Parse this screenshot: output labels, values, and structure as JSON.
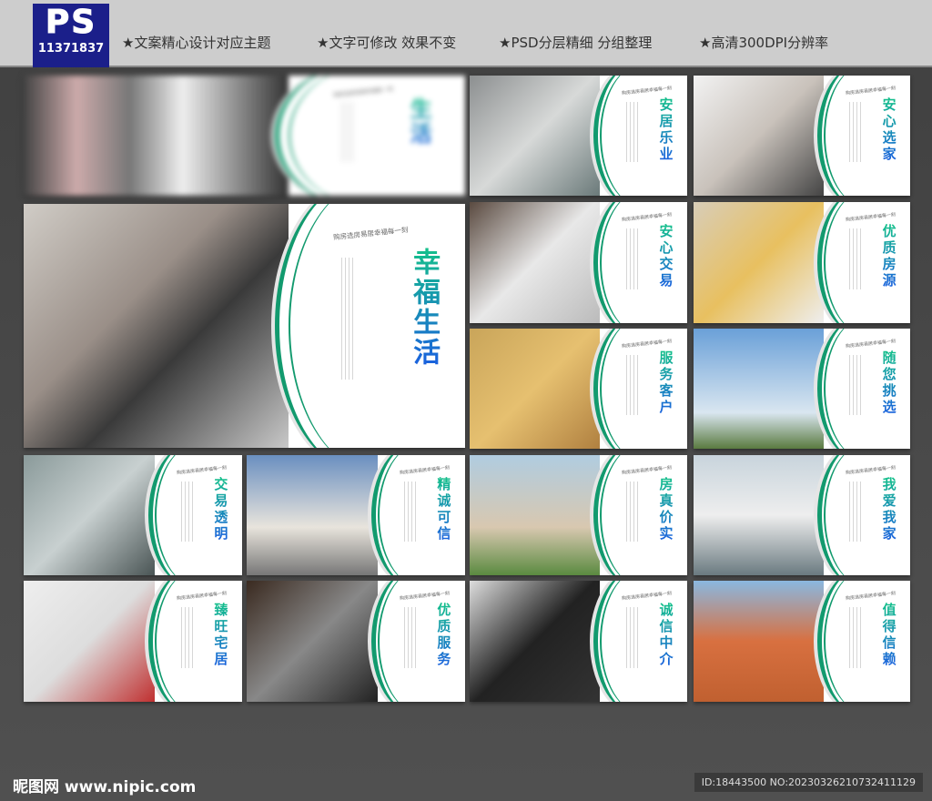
{
  "header": {
    "logo_text": "PS",
    "logo_id": "11371837",
    "features": [
      "★文案精心设计对应主题",
      "★文字可修改 效果不变",
      "★PSD分层精细 分组整理",
      "★高清300DPI分辨率"
    ]
  },
  "tagline": "购房选房易居幸福每一刻",
  "big_card": {
    "title": "幸福生活"
  },
  "blurred_card": {
    "title": "生活"
  },
  "cards": [
    {
      "title": "安居乐业"
    },
    {
      "title": "安心选家"
    },
    {
      "title": "安心交易"
    },
    {
      "title": "优质房源"
    },
    {
      "title": "服务客户"
    },
    {
      "title": "随您挑选"
    },
    {
      "title": "交易透明"
    },
    {
      "title": "精诚可信"
    },
    {
      "title": "房真价实"
    },
    {
      "title": "我爱我家"
    },
    {
      "title": "臻旺宅居"
    },
    {
      "title": "优质服务"
    },
    {
      "title": "诚信中介"
    },
    {
      "title": "值得信赖"
    }
  ],
  "footer": {
    "site": "昵图网 www.nipic.com",
    "id": "ID:18443500 NO:20230326210732411129"
  }
}
